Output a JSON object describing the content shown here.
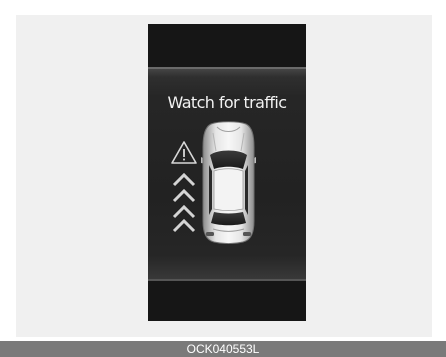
{
  "display": {
    "message": "Watch for traffic"
  },
  "icons": {
    "warning": "warning-triangle-icon",
    "approach": "triple-chevron-up-icon",
    "vehicle": "car-top-view-icon"
  },
  "caption": {
    "code": "OCK040553L"
  },
  "colors": {
    "display_bg": "#161616",
    "band_bg": "#262626",
    "text": "#f2f2f2",
    "caption_bar": "#7a7a7a"
  }
}
